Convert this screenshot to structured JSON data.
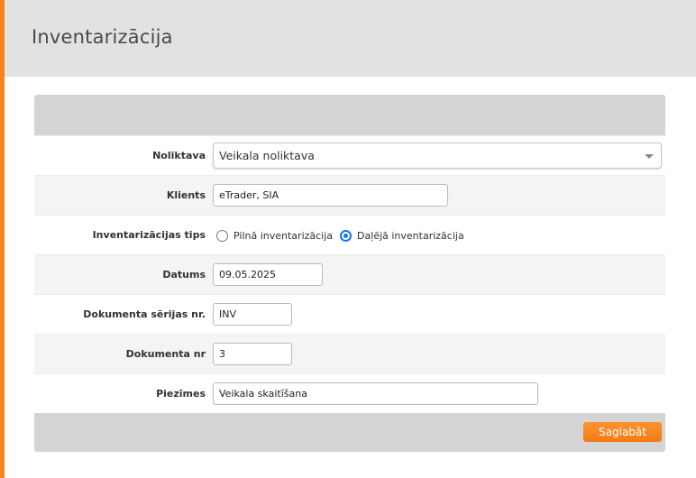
{
  "colors": {
    "accent": "#f7841c",
    "header_bg": "#e2e2e2",
    "panel_bar": "#d4d4d4",
    "radio_checked": "#1a73e8"
  },
  "header": {
    "title": "Inventarizācija"
  },
  "form": {
    "warehouse": {
      "label": "Noliktava",
      "value": "Veikala noliktava"
    },
    "client": {
      "label": "Klients",
      "value": "eTrader, SIA"
    },
    "inventory_type": {
      "label": "Inventarizācijas tips",
      "options": [
        {
          "label": "Pilnā inventarizācija",
          "selected": false
        },
        {
          "label": "Daļējā inventarizācija",
          "selected": true
        }
      ]
    },
    "date": {
      "label": "Datums",
      "value": "09.05.2025"
    },
    "doc_series": {
      "label": "Dokumenta sērijas nr.",
      "value": "INV"
    },
    "doc_number": {
      "label": "Dokumenta nr",
      "value": "3"
    },
    "notes": {
      "label": "Piezīmes",
      "value": "Veikala skaitīšana"
    }
  },
  "footer": {
    "save_label": "Saglabāt"
  }
}
